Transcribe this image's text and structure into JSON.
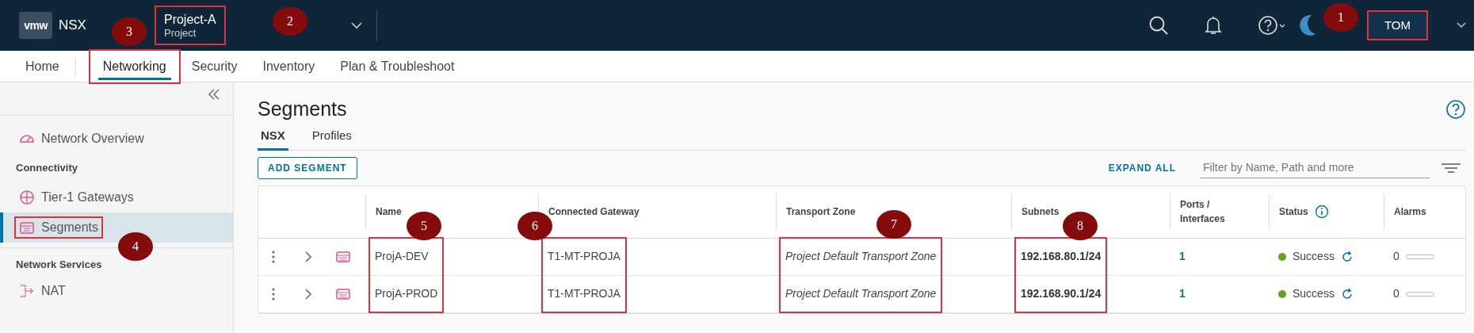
{
  "header": {
    "logo": "vmw",
    "product": "NSX",
    "project": {
      "name": "Project-A",
      "label": "Project",
      "annotated": true
    },
    "user": {
      "name": "TOM",
      "annotated": true
    }
  },
  "nav_tabs": [
    {
      "label": "Home",
      "selected": false,
      "annotated": false
    },
    {
      "label": "Networking",
      "selected": true,
      "annotated": true
    },
    {
      "label": "Security",
      "selected": false,
      "annotated": false
    },
    {
      "label": "Inventory",
      "selected": false,
      "annotated": false
    },
    {
      "label": "Plan & Troubleshoot",
      "selected": false,
      "annotated": false
    }
  ],
  "sidebar": {
    "items": [
      {
        "kind": "link",
        "label": "Network Overview",
        "selected": false,
        "annotated": false
      },
      {
        "kind": "heading",
        "label": "Connectivity"
      },
      {
        "kind": "link",
        "label": "Tier-1 Gateways",
        "selected": false,
        "annotated": false
      },
      {
        "kind": "link",
        "label": "Segments",
        "selected": true,
        "annotated": true
      },
      {
        "kind": "heading",
        "label": "Network Services"
      },
      {
        "kind": "link",
        "label": "NAT",
        "selected": false,
        "annotated": false
      }
    ]
  },
  "page": {
    "title": "Segments",
    "tabs": [
      {
        "label": "NSX",
        "selected": true
      },
      {
        "label": "Profiles",
        "selected": false
      }
    ],
    "add_button": "ADD SEGMENT",
    "expand_all": "EXPAND ALL",
    "filter": {
      "placeholder": "Filter by Name, Path and more"
    }
  },
  "table": {
    "columns": [
      {
        "kind": "name",
        "label": "Name",
        "annotated": true
      },
      {
        "kind": "gateway",
        "label": "Connected Gateway",
        "annotated": true
      },
      {
        "kind": "zone",
        "label": "Transport Zone",
        "annotated": true
      },
      {
        "kind": "subnets",
        "label": "Subnets",
        "annotated": true
      },
      {
        "kind": "ports",
        "label": "Ports / Interfaces"
      },
      {
        "kind": "status",
        "label": "Status"
      },
      {
        "kind": "alarms",
        "label": "Alarms"
      }
    ],
    "rows": [
      {
        "name": "ProjA-DEV",
        "gateway": "T1-MT-PROJA",
        "zone": "Project Default Transport Zone",
        "subnets": "192.168.80.1/24",
        "ports": "1",
        "status": "Success",
        "color": "#62a420",
        "alarms": "0"
      },
      {
        "name": "ProjA-PROD",
        "gateway": "T1-MT-PROJA",
        "zone": "Project Default Transport Zone",
        "subnets": "192.168.90.1/24",
        "ports": "1",
        "status": "Success",
        "color": "#62a420",
        "alarms": "0"
      }
    ]
  },
  "callouts": [
    {
      "number": "1"
    },
    {
      "number": "2"
    },
    {
      "number": "3"
    },
    {
      "number": "4"
    },
    {
      "number": "5"
    },
    {
      "number": "6"
    },
    {
      "number": "7"
    },
    {
      "number": "8"
    }
  ]
}
